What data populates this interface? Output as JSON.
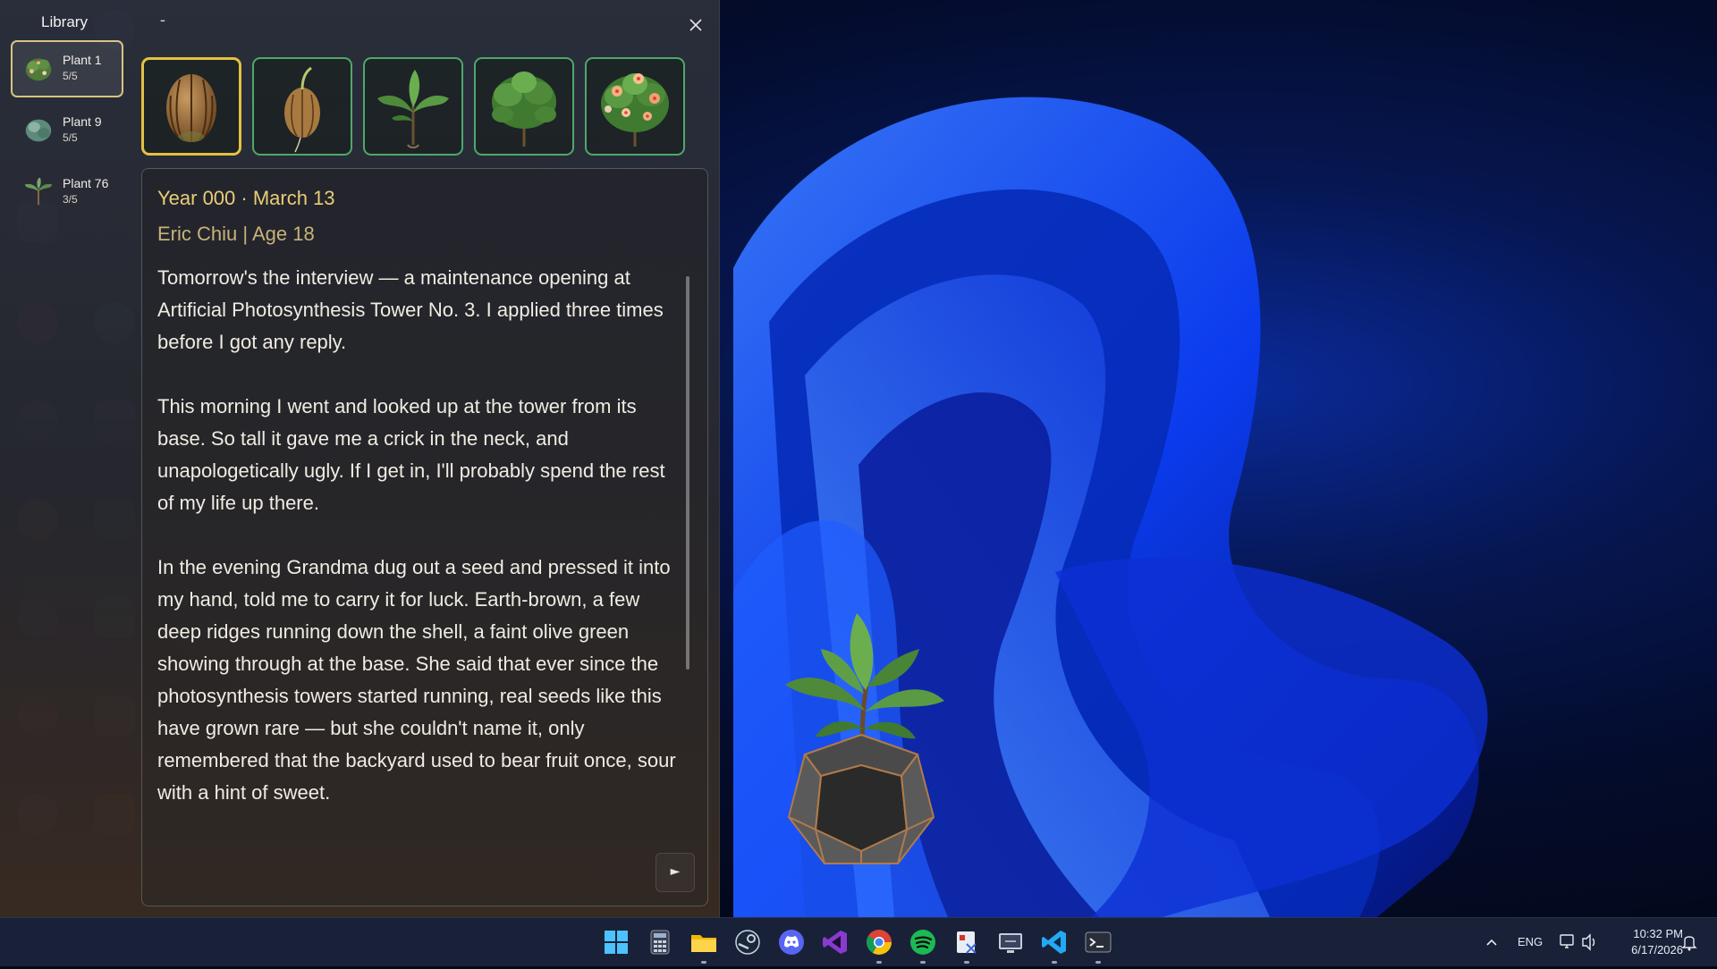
{
  "library": {
    "title": "Library",
    "minimize_label": "-",
    "close_icon": "close-icon",
    "plants": [
      {
        "name": "Plant 1",
        "progress": "5/5",
        "selected": true
      },
      {
        "name": "Plant 9",
        "progress": "5/5",
        "selected": false
      },
      {
        "name": "Plant 76",
        "progress": "3/5",
        "selected": false
      }
    ],
    "stages": [
      {
        "icon": "seed-icon",
        "selected": true
      },
      {
        "icon": "sprout-seed-icon",
        "selected": false
      },
      {
        "icon": "seedling-icon",
        "selected": false
      },
      {
        "icon": "bush-icon",
        "selected": false
      },
      {
        "icon": "flowering-bush-icon",
        "selected": false
      }
    ]
  },
  "journal": {
    "date": "Year 000 · March 13",
    "author": "Eric Chiu | Age 18",
    "paragraphs": [
      "Tomorrow's the interview — a maintenance opening at Artificial Photosynthesis Tower No. 3. I applied three times before I got any reply.",
      "This morning I went and looked up at the tower from its base. So tall it gave me a crick in the neck, and unapologetically ugly. If I get in, I'll probably spend the rest of my life up there.",
      "In the evening Grandma dug out a seed and pressed it into my hand, told me to carry it for luck. Earth-brown, a few deep ridges running down the shell, a faint olive green showing through at the base. She said that ever since the photosynthesis towers started running, real seeds like this have grown rare — but she couldn't name it, only remembered that the backyard used to bear fruit once, sour with a hint of sweet."
    ],
    "next_label": "►"
  },
  "taskbar": {
    "apps": [
      "windows-start-icon",
      "calculator-icon",
      "file-explorer-icon",
      "steam-icon",
      "discord-icon",
      "visual-studio-icon",
      "chrome-icon",
      "spotify-icon",
      "snipping-tool-icon",
      "remote-desktop-icon",
      "vscode-icon",
      "terminal-icon"
    ],
    "tray": {
      "language": "ENG",
      "time": "10:32 PM",
      "date": "6/17/2026"
    }
  },
  "colors": {
    "accent_gold": "#e5c042",
    "stage_border": "#4fa86a",
    "date_text": "#e9cd77",
    "wallpaper_blue": "#0a3cf0"
  }
}
